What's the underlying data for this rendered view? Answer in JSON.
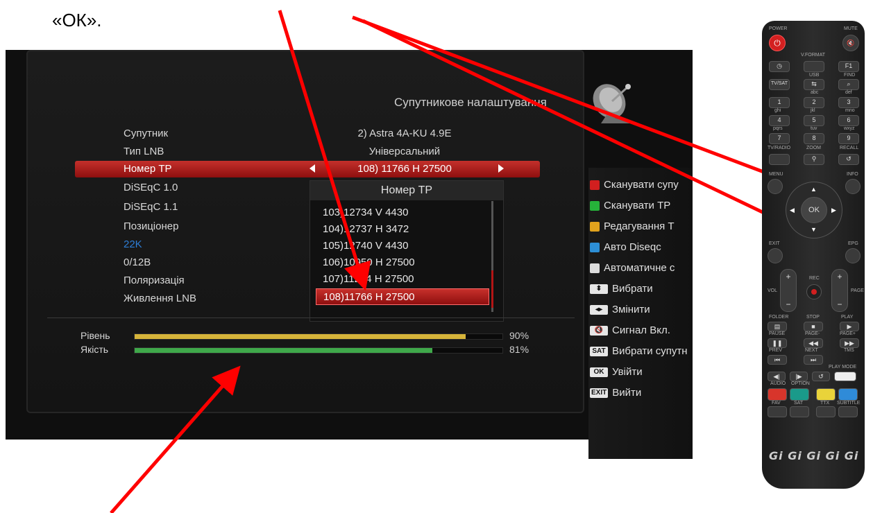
{
  "document": {
    "ok_caption": "«ОК»."
  },
  "tv": {
    "menu_title": "Супутникове налаштування",
    "rows": [
      {
        "label": "Супутник",
        "value": "2) Astra 4A-KU 4.9E"
      },
      {
        "label": "Тип LNB",
        "value": "Універсальний"
      },
      {
        "label": "Номер TP",
        "value": "108) 11766 H 27500",
        "selected": true
      },
      {
        "label": "DiSEqC 1.0",
        "value": ""
      },
      {
        "label": "DiSEqC 1.1",
        "value": ""
      },
      {
        "label": "Позиціонер",
        "value": ""
      },
      {
        "label": "22K",
        "value": "",
        "highlight": true
      },
      {
        "label": "0/12В",
        "value": ""
      },
      {
        "label": "Поляризація",
        "value": ""
      },
      {
        "label": "Живлення LNB",
        "value": ""
      }
    ],
    "tp_popup": {
      "title": "Номер TP",
      "items": [
        "103)12734 V 4430",
        "104)12737 H 3472",
        "105)12740 V 4430",
        "106)10950 H 27500",
        "107)11264 H 27500",
        "108)11766 H 27500"
      ],
      "selected_index": 5
    },
    "signal": {
      "level_label": "Рівень",
      "level_value": 90,
      "level_text": "90%",
      "quality_label": "Якість",
      "quality_value": 81,
      "quality_text": "81%"
    },
    "legend": [
      {
        "key": "red",
        "color": "#d21f1f",
        "text": "Сканувати супу"
      },
      {
        "key": "green",
        "color": "#26b33a",
        "text": "Сканувати TP"
      },
      {
        "key": "yellow",
        "color": "#e0a21d",
        "text": "Редагування Т"
      },
      {
        "key": "blue",
        "color": "#2d8fd6",
        "text": "Авто Diseqc"
      },
      {
        "key": "white",
        "color": "#dddddd",
        "text": "Автоматичне с"
      },
      {
        "key": "updown",
        "keycap": "⬍",
        "text": "Вибрати"
      },
      {
        "key": "leftright",
        "keycap": "◂▸",
        "text": "Змінити"
      },
      {
        "key": "mute",
        "keycap": "🔇",
        "text": "Сигнал Вкл."
      },
      {
        "key": "sat",
        "keycap": "SAT",
        "text": "Вибрати супутн"
      },
      {
        "key": "ok",
        "keycap": "OK",
        "text": "Увійти"
      },
      {
        "key": "exit",
        "keycap": "EXIT",
        "text": "Вийти"
      }
    ]
  },
  "remote": {
    "labels": {
      "power": "POWER",
      "mute": "MUTE",
      "vformat": "V.FORMAT",
      "f1": "F1",
      "usb": "USB",
      "find": "FIND",
      "tvsat": "TV/SAT",
      "abc": "abc",
      "def": "def",
      "ghi": "ghi",
      "jkl": "jkl",
      "mno": "mno",
      "pqrs": "pqrs",
      "tuv": "tuv",
      "wxyz": "wxyz",
      "tvradio": "TV/RADIO",
      "zoom": "ZOOM",
      "recall": "RECALL",
      "menu": "MENU",
      "info": "INFO",
      "ok": "OK",
      "exit": "EXIT",
      "epg": "EPG",
      "rec": "REC",
      "vol": "VOL",
      "page": "PAGE",
      "folder": "FOLDER",
      "stop": "STOP",
      "play": "PLAY",
      "pause": "PAUSE",
      "pageminus": "PAGE-",
      "pageplus": "PAGE+",
      "prev": "PREV",
      "next": "NEXT",
      "tms": "TMS",
      "playmode": "PLAY MODE",
      "audio": "AUDIO",
      "option": "OPTION",
      "ttx": "TTX",
      "fav": "FAV",
      "sat": "SAT",
      "subtitle": "SUBTITLE",
      "brand": "Gi Gi Gi Gi Gi"
    },
    "digits": [
      "1",
      "2",
      "3",
      "4",
      "5",
      "6",
      "7",
      "8",
      "9"
    ]
  },
  "colors": {
    "red_accent": "#c4302b",
    "arrow": "#ff0000",
    "level_bar": "#d6b43a",
    "quality_bar": "#3fa84a"
  }
}
